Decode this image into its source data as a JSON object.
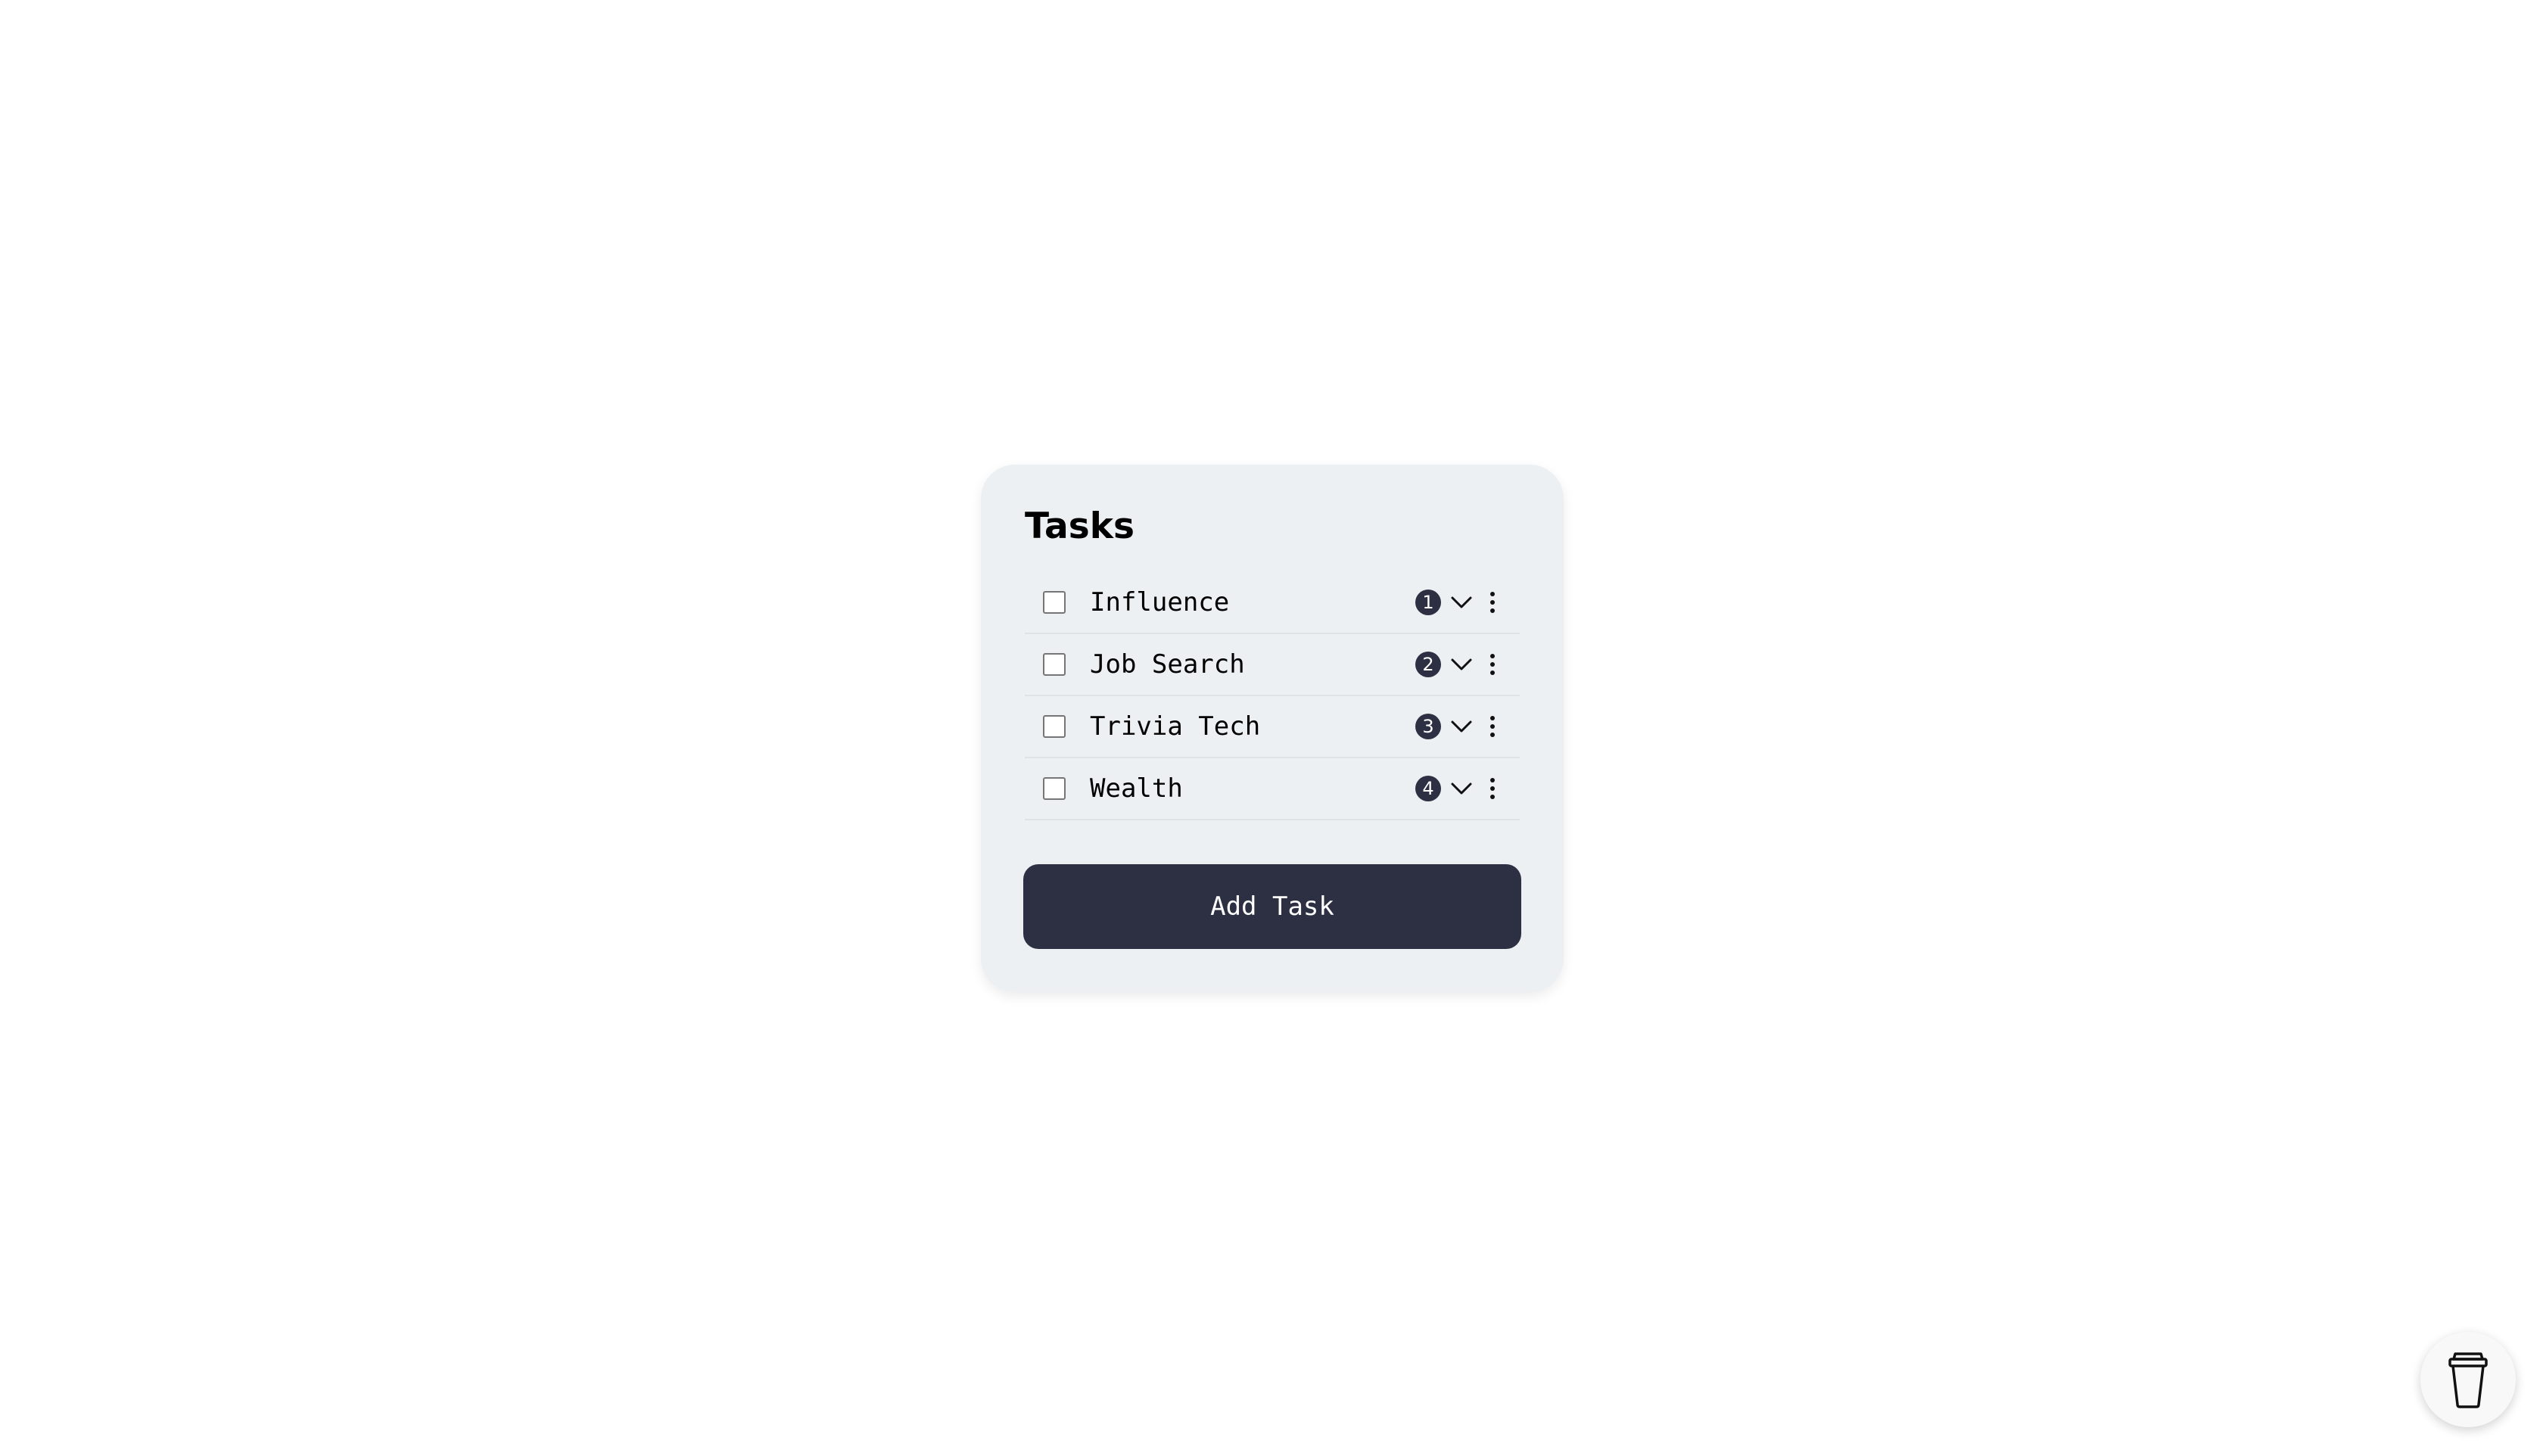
{
  "card": {
    "title": "Tasks"
  },
  "tasks": [
    {
      "label": "Influence",
      "badge": "1",
      "checked": false
    },
    {
      "label": "Job Search",
      "badge": "2",
      "checked": false
    },
    {
      "label": "Trivia Tech",
      "badge": "3",
      "checked": false
    },
    {
      "label": "Wealth",
      "badge": "4",
      "checked": false
    }
  ],
  "add_button": {
    "label": "Add Task"
  },
  "icons": {
    "expand": "chevron-down-icon",
    "menu": "more-vertical-icon",
    "fab": "coffee-cup-icon"
  },
  "colors": {
    "card_background": "#ecf0f2",
    "primary_dark": "#2c3042",
    "badge_text": "#ffffff"
  }
}
